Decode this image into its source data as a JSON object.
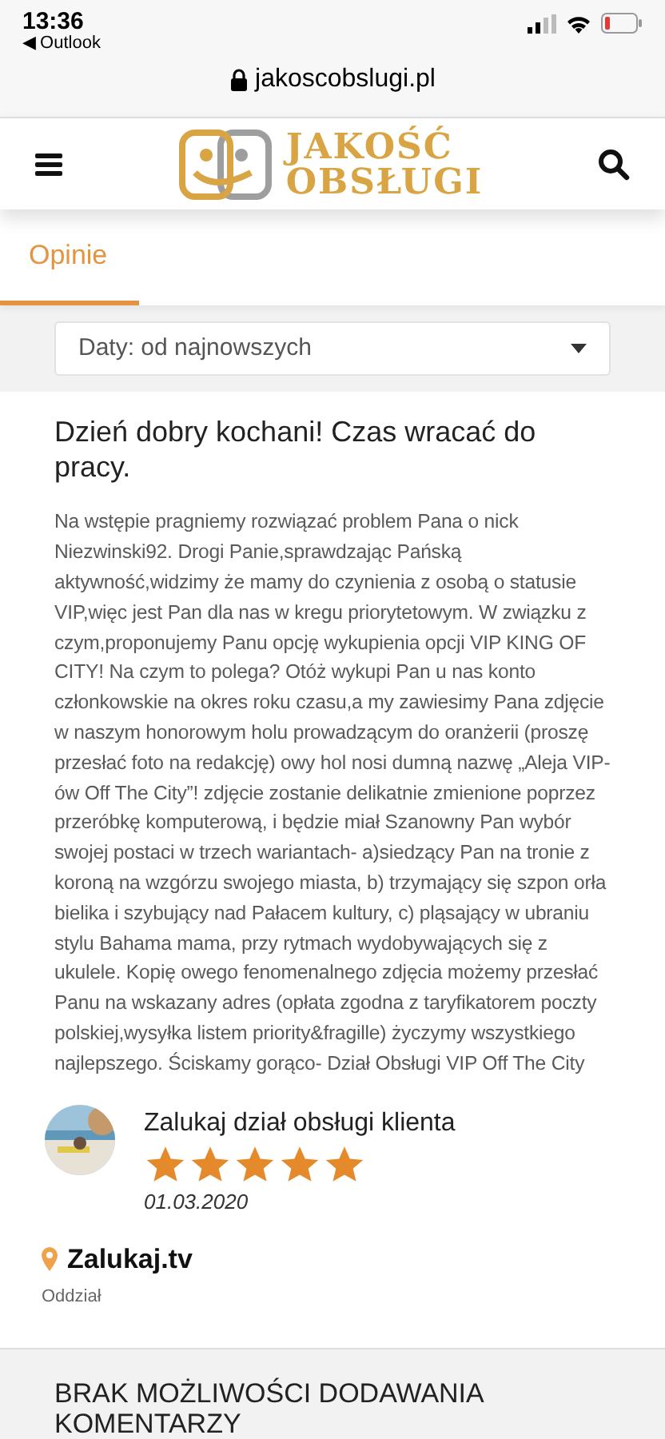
{
  "status_bar": {
    "time": "13:36",
    "back_app": "◀ Outlook"
  },
  "address_bar": {
    "url": "jakoscobslugi.pl"
  },
  "header": {
    "logo_line_1": "JAKOŚĆ",
    "logo_line_2": "OBSŁUGI"
  },
  "tabs": [
    {
      "label": "Opinie",
      "selected": true
    }
  ],
  "sort_select": {
    "value": "Daty: od najnowszych"
  },
  "review": {
    "title": "Dzień dobry kochani! Czas wracać do pracy.",
    "body": "Na wstępie pragniemy rozwiązać problem Pana o nick Niezwinski92. Drogi Panie,sprawdzając Pańską aktywność,widzimy że mamy do czynienia z osobą o statusie VIP,więc jest Pan dla nas w kregu priorytetowym. W związku z czym,proponujemy Panu opcję wykupienia opcji VIP KING OF CITY! Na czym to polega? Otóż wykupi Pan u nas konto członkowskie na okres roku czasu,a my zawiesimy Pana zdjęcie w naszym honorowym holu prowadzącym do oranżerii (proszę przesłać foto na redakcję) owy hol nosi dumną nazwę „Aleja VIP-ów Off The City”! zdjęcie zostanie delikatnie zmienione poprzez przeróbkę komputerową, i będzie miał Szanowny Pan wybór swojej postaci w trzech wariantach- a)siedzący Pan na tronie z koroną na wzgórzu swojego miasta, b) trzymający się szpon orła bielika i szybujący nad Pałacem kultury, c) pląsający w ubraniu stylu Bahama mama, przy rytmach wydobywających się z ukulele. Kopię owego fenomenalnego zdjęcia możemy przesłać Panu na wskazany adres (opłata zgodna z taryfikatorem poczty polskiej,wysyłka listem priority&fragille) życzymy wszystkiego najlepszego. Ściskamy gorąco- Dział Obsługi VIP Off The City",
    "author": "Zalukaj dział obsługi klienta",
    "stars": 5,
    "date": "01.03.2020",
    "place": "Zalukaj.tv",
    "place_kind": "Oddział"
  },
  "footer_heading": "BRAK MOŻLIWOŚCI DODAWANIA KOMENTARZY"
}
